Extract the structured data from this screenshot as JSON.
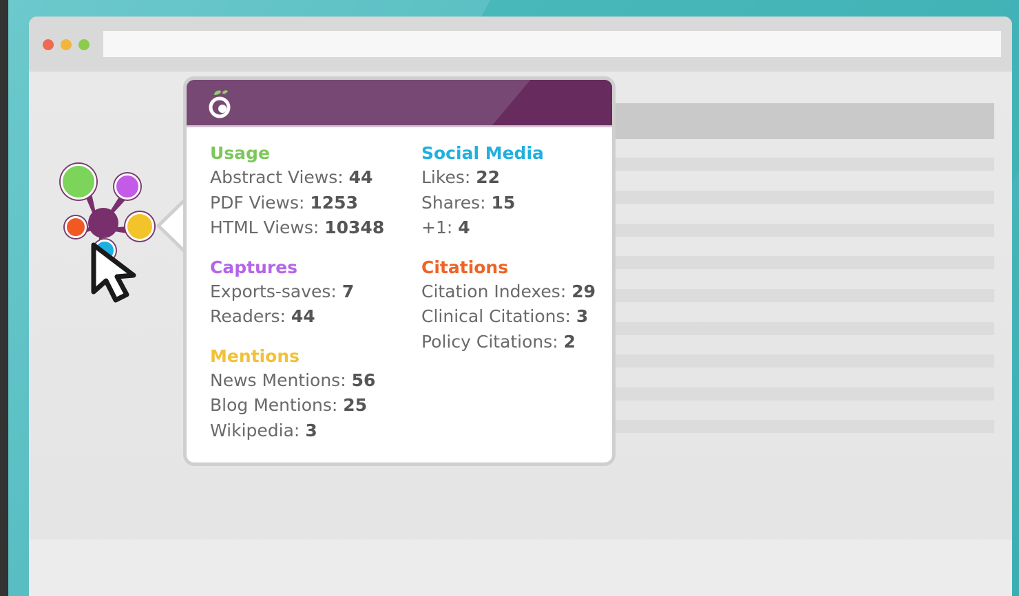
{
  "colors": {
    "usage": "#7cc85a",
    "captures": "#b565e8",
    "mentions": "#f2c13a",
    "social_media": "#20b0e0",
    "citations": "#ee6326",
    "header": "#784874"
  },
  "browser": {
    "window_controls": [
      "close-dot",
      "minimize-dot",
      "maximize-dot"
    ],
    "address_bar_value": ""
  },
  "badge": {
    "icon": "plumx-flower-icon",
    "cursor_icon": "arrow-cursor-icon"
  },
  "popover": {
    "header_logo": "plumx-logo-icon",
    "left_column": [
      {
        "title": "Usage",
        "color_key": "usage",
        "metrics": [
          {
            "label": "Abstract Views:",
            "value": "44"
          },
          {
            "label": "PDF Views:",
            "value": "1253"
          },
          {
            "label": "HTML Views:",
            "value": "10348"
          }
        ]
      },
      {
        "title": "Captures",
        "color_key": "captures",
        "metrics": [
          {
            "label": "Exports-saves:",
            "value": "7"
          },
          {
            "label": "Readers:",
            "value": "44"
          }
        ]
      },
      {
        "title": "Mentions",
        "color_key": "mentions",
        "metrics": [
          {
            "label": "News Mentions:",
            "value": "56"
          },
          {
            "label": "Blog Mentions:",
            "value": "25"
          },
          {
            "label": "Wikipedia:",
            "value": "3"
          }
        ]
      }
    ],
    "right_column": [
      {
        "title": "Social Media",
        "color_key": "social_media",
        "metrics": [
          {
            "label": "Likes:",
            "value": "22"
          },
          {
            "label": "Shares:",
            "value": "15"
          },
          {
            "label": "+1:",
            "value": "4"
          }
        ]
      },
      {
        "title": "Citations",
        "color_key": "citations",
        "metrics": [
          {
            "label": "Citation Indexes:",
            "value": "29"
          },
          {
            "label": "Clinical Citations:",
            "value": "3"
          },
          {
            "label": "Policy Citations:",
            "value": "2"
          }
        ]
      }
    ]
  }
}
